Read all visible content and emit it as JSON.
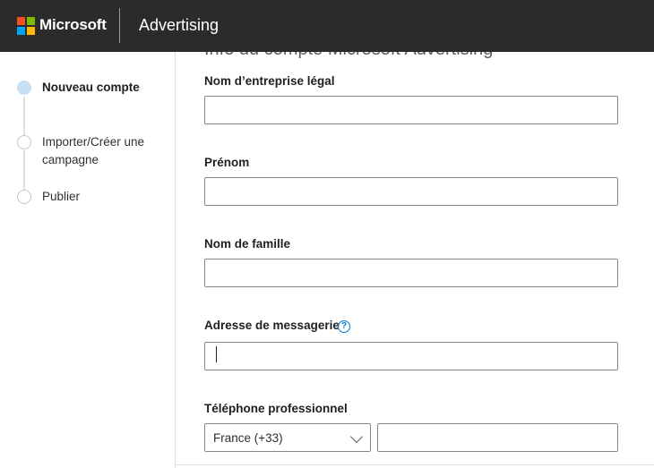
{
  "header": {
    "brand": "Microsoft",
    "product": "Advertising",
    "logo_colors": [
      "#f25022",
      "#7fba00",
      "#00a4ef",
      "#ffb900"
    ],
    "background": "#2b2b2b"
  },
  "sidebar": {
    "steps": [
      {
        "label": "Nouveau compte",
        "active": true
      },
      {
        "label": "Importer/Créer une campagne",
        "active": false
      },
      {
        "label": "Publier",
        "active": false
      }
    ]
  },
  "form": {
    "section_title": "Info du compte Microsoft Advertising",
    "company_label": "Nom d’entreprise légal",
    "company_value": "",
    "first_name_label": "Prénom",
    "first_name_value": "",
    "last_name_label": "Nom de famille",
    "last_name_value": "",
    "email_label": "Adresse de messagerie",
    "email_help_icon": "question-circle-icon",
    "email_value": "",
    "phone_label": "Téléphone professionnel",
    "country_selected": "France (+33)",
    "phone_value": ""
  }
}
